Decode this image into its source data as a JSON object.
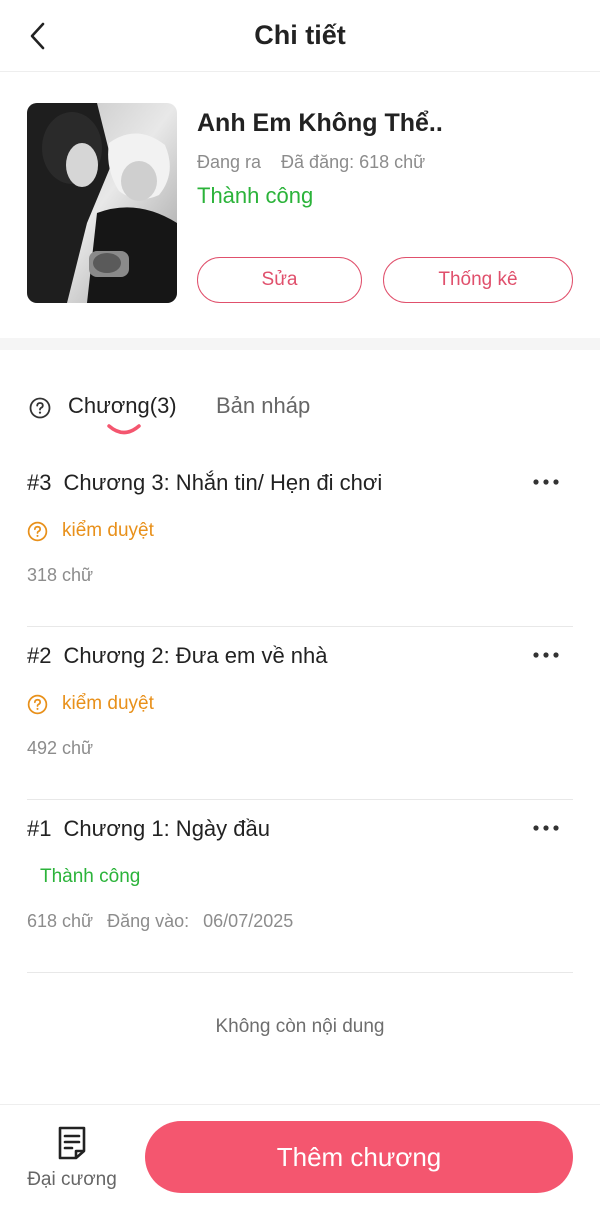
{
  "header": {
    "title": "Chi tiết"
  },
  "book": {
    "title": "Anh Em Không Thể..",
    "state": "Đang ra",
    "published": "Đã đăng: 618 chữ",
    "status": "Thành công",
    "edit_label": "Sửa",
    "stats_label": "Thống kê"
  },
  "tabs": {
    "chapters_label": "Chương(3)",
    "draft_label": "Bản nháp"
  },
  "chapters": [
    {
      "num": "#3",
      "title": "Chương 3: Nhắn tin/ Hẹn đi chơi",
      "status": "kiểm duyệt",
      "words": "318 chữ"
    },
    {
      "num": "#2",
      "title": "Chương 2: Đưa em về nhà",
      "status": "kiểm duyệt",
      "words": "492 chữ"
    },
    {
      "num": "#1",
      "title": "Chương 1: Ngày đầu",
      "status": "Thành công",
      "words": "618 chữ",
      "date_label": "Đăng vào:",
      "date": "06/07/2025"
    }
  ],
  "end_text": "Không còn nội dung",
  "bottom": {
    "outline_label": "Đại cương",
    "add_label": "Thêm chương"
  },
  "colors": {
    "accent": "#f4566f",
    "success": "#2bb33a",
    "pending": "#e8901a"
  }
}
